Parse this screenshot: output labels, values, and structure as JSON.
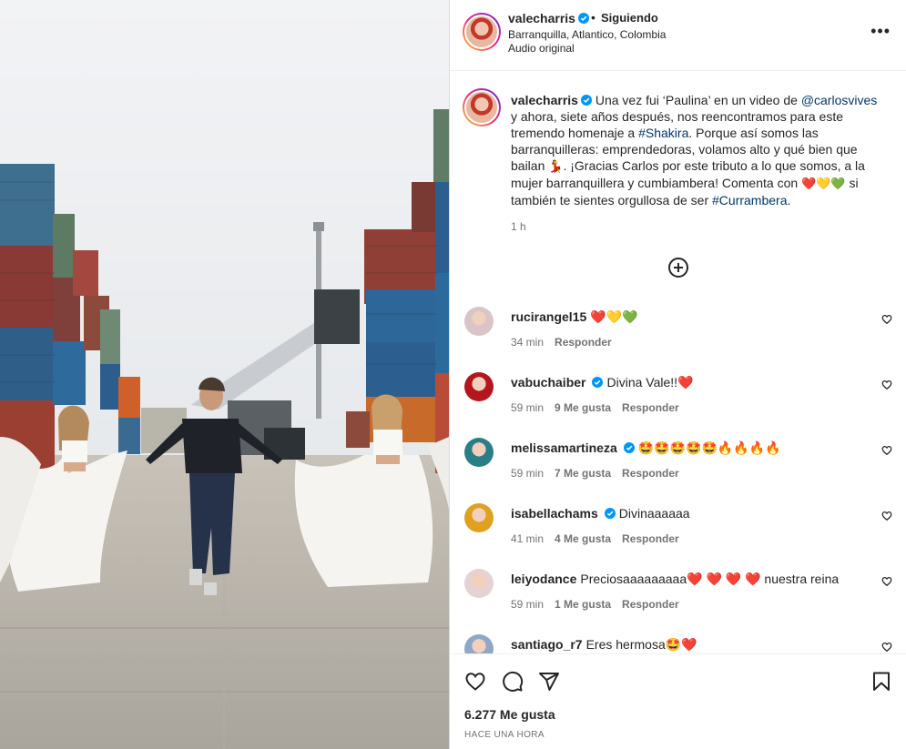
{
  "post": {
    "author": "valecharris",
    "follow_status": "Siguiendo",
    "location": "Barranquilla, Atlantico, Colombia",
    "audio": "Audio original",
    "more_icon": "•••"
  },
  "caption": {
    "author": "valecharris",
    "part1": "Una vez fui ‘Paulina’ en un video de ",
    "mention": "@carlosvives",
    "part2": " y ahora, siete años después, nos reencontramos para este tremendo homenaje a ",
    "hashtag1": "#Shakira",
    "part3": ". Porque así somos las barranquilleras: emprendedoras, volamos alto y qué bien que bailan ",
    "dance_emoji": "💃",
    "part4": ". ¡Gracias Carlos por este tributo a lo que somos, a la mujer barranquillera y cumbiambera! Comenta con ",
    "hearts": "❤️💛💚",
    "part5": " si también te sientes orgullosa de ser ",
    "hashtag2": "#Currambera",
    "part6": ".",
    "time": "1 h"
  },
  "comments": [
    {
      "user": "rucirangel15",
      "text": "❤️💛💚",
      "time": "34 min",
      "likes": "",
      "reply": "Responder",
      "avatar_color": "#d9c4c8",
      "verified": false
    },
    {
      "user": "vabuchaiber",
      "text": "Divina Vale!!❤️",
      "time": "59 min",
      "likes": "9 Me gusta",
      "reply": "Responder",
      "avatar_color": "#b5161d",
      "verified": true
    },
    {
      "user": "melissamartineza",
      "text": "🤩🤩🤩🤩🤩🔥🔥🔥🔥",
      "time": "59 min",
      "likes": "7 Me gusta",
      "reply": "Responder",
      "avatar_color": "#2a7f86",
      "verified": true
    },
    {
      "user": "isabellachams",
      "text": "Divinaaaaaa",
      "time": "41 min",
      "likes": "4 Me gusta",
      "reply": "Responder",
      "avatar_color": "#e0a020",
      "verified": true
    },
    {
      "user": "leiyodance",
      "text": "Preciosaaaaaaaaa❤️ ❤️ ❤️ ❤️ nuestra reina",
      "time": "59 min",
      "likes": "1 Me gusta",
      "reply": "Responder",
      "avatar_color": "#e6d2d2",
      "verified": false
    },
    {
      "user": "santiago_r7",
      "text": "Eres hermosa🤩❤️",
      "time": "",
      "likes": "",
      "reply": "",
      "avatar_color": "#8fa8c8",
      "verified": false
    }
  ],
  "footer": {
    "likes": "6.277 Me gusta",
    "ago": "HACE UNA HORA"
  },
  "colors": {
    "link": "#00376b",
    "verified": "#0095f6",
    "muted": "#737373",
    "text": "#262626"
  }
}
